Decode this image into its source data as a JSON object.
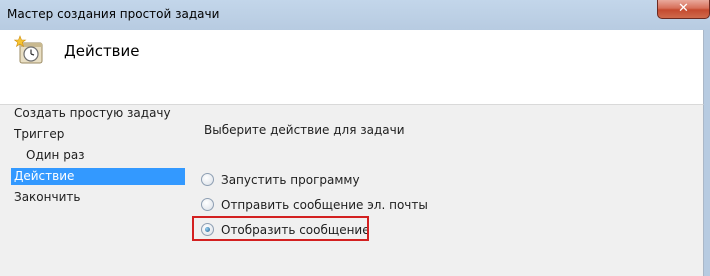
{
  "window": {
    "title": "Мастер создания простой задачи",
    "close_label": "✕"
  },
  "header": {
    "title": "Действие",
    "icon": "task-clock-icon"
  },
  "nav": {
    "items": [
      {
        "label": "Создать простую задачу",
        "selected": false
      },
      {
        "label": "Триггер",
        "selected": false
      },
      {
        "label": "Один раз",
        "selected": false
      },
      {
        "label": "Действие",
        "selected": true
      },
      {
        "label": "Закончить",
        "selected": false
      }
    ]
  },
  "main": {
    "prompt": "Выберите действие для задачи",
    "options": [
      {
        "label": "Запустить программу",
        "checked": false
      },
      {
        "label": "Отправить сообщение эл. почты",
        "checked": false
      },
      {
        "label": "Отобразить сообщение",
        "checked": true
      }
    ]
  },
  "colors": {
    "selection": "#3399ff",
    "highlight_border": "#d32020"
  }
}
